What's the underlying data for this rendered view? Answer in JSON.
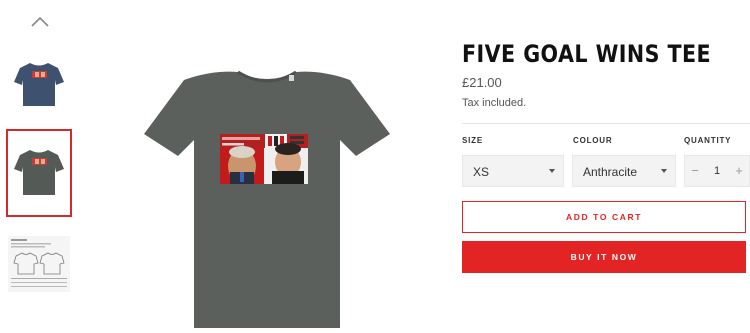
{
  "gallery": {
    "up_icon": "chevron-up-icon",
    "thumbnails": [
      {
        "name": "navy-tee-thumbnail",
        "shirt_color": "#3e5270"
      },
      {
        "name": "anthracite-tee-thumbnail",
        "shirt_color": "#545a56",
        "selected": true
      },
      {
        "name": "size-guide-thumbnail"
      }
    ]
  },
  "product": {
    "title": "FIVE GOAL WINS TEE",
    "price": "£21.00",
    "tax_note": "Tax included.",
    "shirt_color": "#5b605d"
  },
  "options": {
    "size_label": "SIZE",
    "size_value": "XS",
    "colour_label": "COLOUR",
    "colour_value": "Anthracite",
    "quantity_label": "QUANTITY",
    "quantity_value": "1",
    "minus": "−",
    "plus": "+"
  },
  "actions": {
    "add_to_cart": "ADD TO CART",
    "buy_now": "BUY IT NOW"
  },
  "colors": {
    "accent": "#e22424",
    "selected_border": "#d62a2a"
  }
}
